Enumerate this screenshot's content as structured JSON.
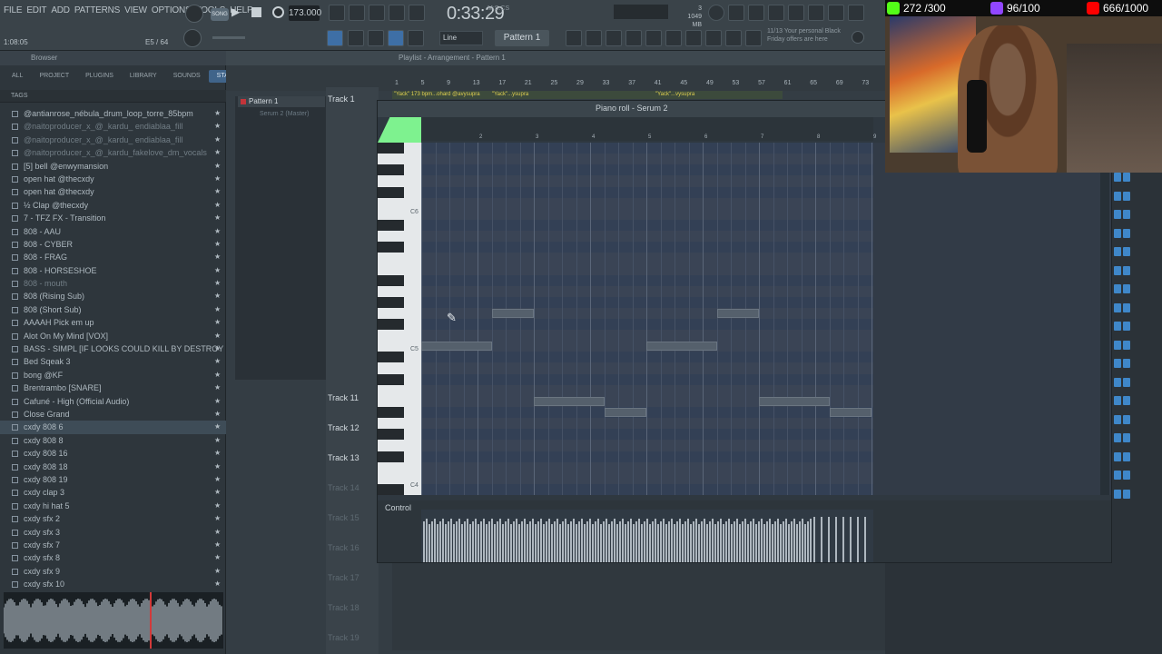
{
  "menu": [
    "FILE",
    "EDIT",
    "ADD",
    "PATTERNS",
    "VIEW",
    "OPTIONS",
    "TOOLS",
    "HELP"
  ],
  "transport": {
    "song_label": "SONG",
    "tempo": "173.000",
    "time": "0:33:29",
    "time_sub": "M:S:CS",
    "memory_line1": "3",
    "memory_line2": "1049 MB",
    "memory_line3": "0",
    "song_position": "1:08:05",
    "bar_position": "E5 / 64",
    "snap": "Line",
    "pattern": "Pattern 1",
    "news": "11/13 Your personal Black Friday offers are here"
  },
  "browser": {
    "title": "Browser",
    "tabs": [
      "ALL",
      "PROJECT",
      "PLUGINS",
      "LIBRARY",
      "SOUNDS",
      "STARRED"
    ],
    "active_tab": "STARRED",
    "tags_label": "TAGS",
    "items": [
      {
        "label": "@antianrose_nébula_drum_loop_torre_85bpm",
        "dim": false
      },
      {
        "label": "@naitoproducer_x_@_kardu_ endiablaa_fill",
        "dim": true
      },
      {
        "label": "@naitoproducer_x_@_kardu_ endiablaa_fill",
        "dim": true
      },
      {
        "label": "@naitoproducer_x_@_kardu_fakelove_dm_vocals",
        "dim": true
      },
      {
        "label": "[5] bell @enwymansion",
        "dim": false
      },
      {
        "label": "open hat @thecxdy",
        "dim": false
      },
      {
        "label": "open hat @thecxdy",
        "dim": false
      },
      {
        "label": "½ Clap @thecxdy",
        "dim": false
      },
      {
        "label": "7 - TFZ FX - Transition",
        "dim": false
      },
      {
        "label": "808 - AAU",
        "dim": false
      },
      {
        "label": "808 - CYBER",
        "dim": false
      },
      {
        "label": "808 - FRAG",
        "dim": false
      },
      {
        "label": "808 - HORSESHOE",
        "dim": false
      },
      {
        "label": "808 - mouth",
        "dim": true
      },
      {
        "label": "808 (Rising Sub)",
        "dim": false
      },
      {
        "label": "808 (Short Sub)",
        "dim": false
      },
      {
        "label": "AAAAH Pick em up",
        "dim": false
      },
      {
        "label": "Alot On My Mind [VOX]",
        "dim": false
      },
      {
        "label": "BASS - SIMPL [IF LOOKS COULD KILL BY DESTROY LONELY]",
        "dim": false
      },
      {
        "label": "Bed Sqeak 3",
        "dim": false
      },
      {
        "label": "bong @KF",
        "dim": false
      },
      {
        "label": "Brentrambo [SNARE]",
        "dim": false
      },
      {
        "label": "Cafuné - High (Official Audio)",
        "dim": false
      },
      {
        "label": "Close Grand",
        "dim": false
      },
      {
        "label": "cxdy 808 6",
        "dim": false
      },
      {
        "label": "cxdy 808 8",
        "dim": false
      },
      {
        "label": "cxdy 808 16",
        "dim": false
      },
      {
        "label": "cxdy 808 18",
        "dim": false
      },
      {
        "label": "cxdy 808 19",
        "dim": false
      },
      {
        "label": "cxdy clap 3",
        "dim": false
      },
      {
        "label": "cxdy hi hat 5",
        "dim": false
      },
      {
        "label": "cxdy sfx 2",
        "dim": false
      },
      {
        "label": "cxdy sfx 3",
        "dim": false
      },
      {
        "label": "cxdy sfx 7",
        "dim": false
      },
      {
        "label": "cxdy sfx 8",
        "dim": false
      },
      {
        "label": "cxdy sfx 9",
        "dim": false
      },
      {
        "label": "cxdy sfx 10",
        "dim": false
      }
    ],
    "selected_index": 24
  },
  "playlist": {
    "title": "Playlist - Arrangement - Pattern 1",
    "pattern_label": "Pattern 1",
    "pattern_sub": "Serum 2 (Master)",
    "timeline": [
      "1",
      "5",
      "9",
      "13",
      "17",
      "21",
      "25",
      "29",
      "33",
      "37",
      "41",
      "45",
      "49",
      "53",
      "57",
      "61",
      "65",
      "69",
      "73"
    ],
    "clip1": "\"Yack\" 173 bpm...ohard @avysupra",
    "clip2": "\"Yack\"...ysupra",
    "clip3": "\"Yack\"...vysupra",
    "tracks": [
      {
        "label": "Track 1",
        "dim": false
      },
      {
        "label": "Track 11",
        "dim": false
      },
      {
        "label": "Track 12",
        "dim": false
      },
      {
        "label": "Track 13",
        "dim": false
      },
      {
        "label": "Track 14",
        "dim": true
      },
      {
        "label": "Track 15",
        "dim": true
      },
      {
        "label": "Track 16",
        "dim": true
      },
      {
        "label": "Track 17",
        "dim": true
      },
      {
        "label": "Track 18",
        "dim": true
      },
      {
        "label": "Track 19",
        "dim": true
      }
    ]
  },
  "piano_roll": {
    "title": "Piano roll - Serum 2",
    "ruler": [
      "2",
      "3",
      "4",
      "5",
      "6",
      "7",
      "8",
      "9"
    ],
    "key_labels": [
      "C6",
      "C5",
      "C4"
    ],
    "control_label": "Control",
    "notes": [
      {
        "row": 15,
        "start": 1.25,
        "len": 0.75
      },
      {
        "row": 15,
        "start": 5.25,
        "len": 0.75
      },
      {
        "row": 18,
        "start": 0.0,
        "len": 1.25
      },
      {
        "row": 18,
        "start": 4.0,
        "len": 1.25
      },
      {
        "row": 23,
        "start": 2.0,
        "len": 1.25
      },
      {
        "row": 23,
        "start": 6.0,
        "len": 1.25
      },
      {
        "row": 24,
        "start": 3.25,
        "len": 0.75
      },
      {
        "row": 24,
        "start": 7.25,
        "len": 0.75
      }
    ]
  },
  "stream": {
    "kick_count": "272 /300",
    "sub_count": "96/100",
    "yt_count": "666/1000",
    "colors": {
      "kick": "#53fc18",
      "sub": "#9146ff",
      "yt": "#ff0000"
    }
  }
}
